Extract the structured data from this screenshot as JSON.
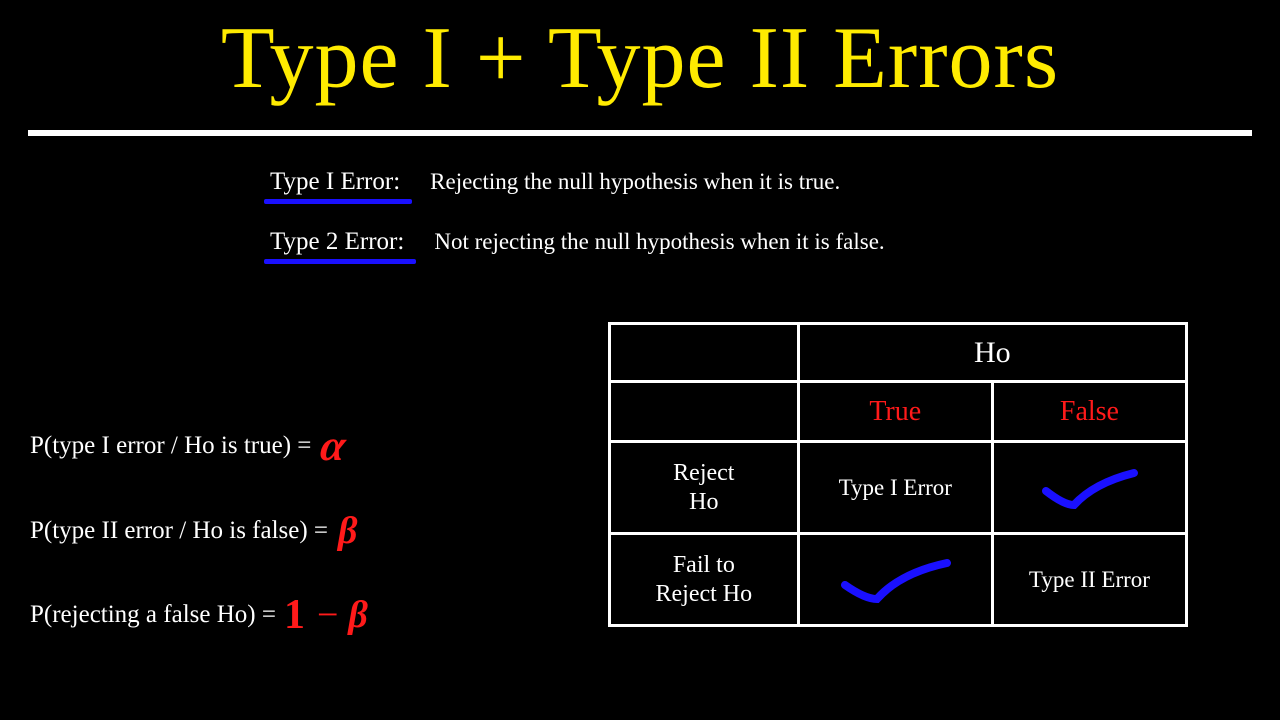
{
  "title": "Type I + Type II Errors",
  "definitions": {
    "type1": {
      "label": "Type I Error:",
      "text": "Rejecting the null hypothesis when it is true."
    },
    "type2": {
      "label": "Type 2 Error:",
      "text": "Not rejecting the null hypothesis when it is false."
    }
  },
  "formulas": {
    "f1": {
      "lhs": "P(type I error / Ho is true)  = ",
      "rhs": "α"
    },
    "f2": {
      "lhs": "P(type II error / Ho is false)  = ",
      "rhs": "β"
    },
    "f3": {
      "lhs": "P(rejecting a false Ho) = ",
      "rhs_one": "1",
      "rhs_minus": "−",
      "rhs_beta": "β"
    }
  },
  "table": {
    "header_top": "Ho",
    "header_true": "True",
    "header_false": "False",
    "row1_label_a": "Reject",
    "row1_label_b": "Ho",
    "row1_true": "Type I Error",
    "row1_false": "check",
    "row2_label_a": "Fail to",
    "row2_label_b": "Reject Ho",
    "row2_true": "check",
    "row2_false": "Type II Error"
  }
}
